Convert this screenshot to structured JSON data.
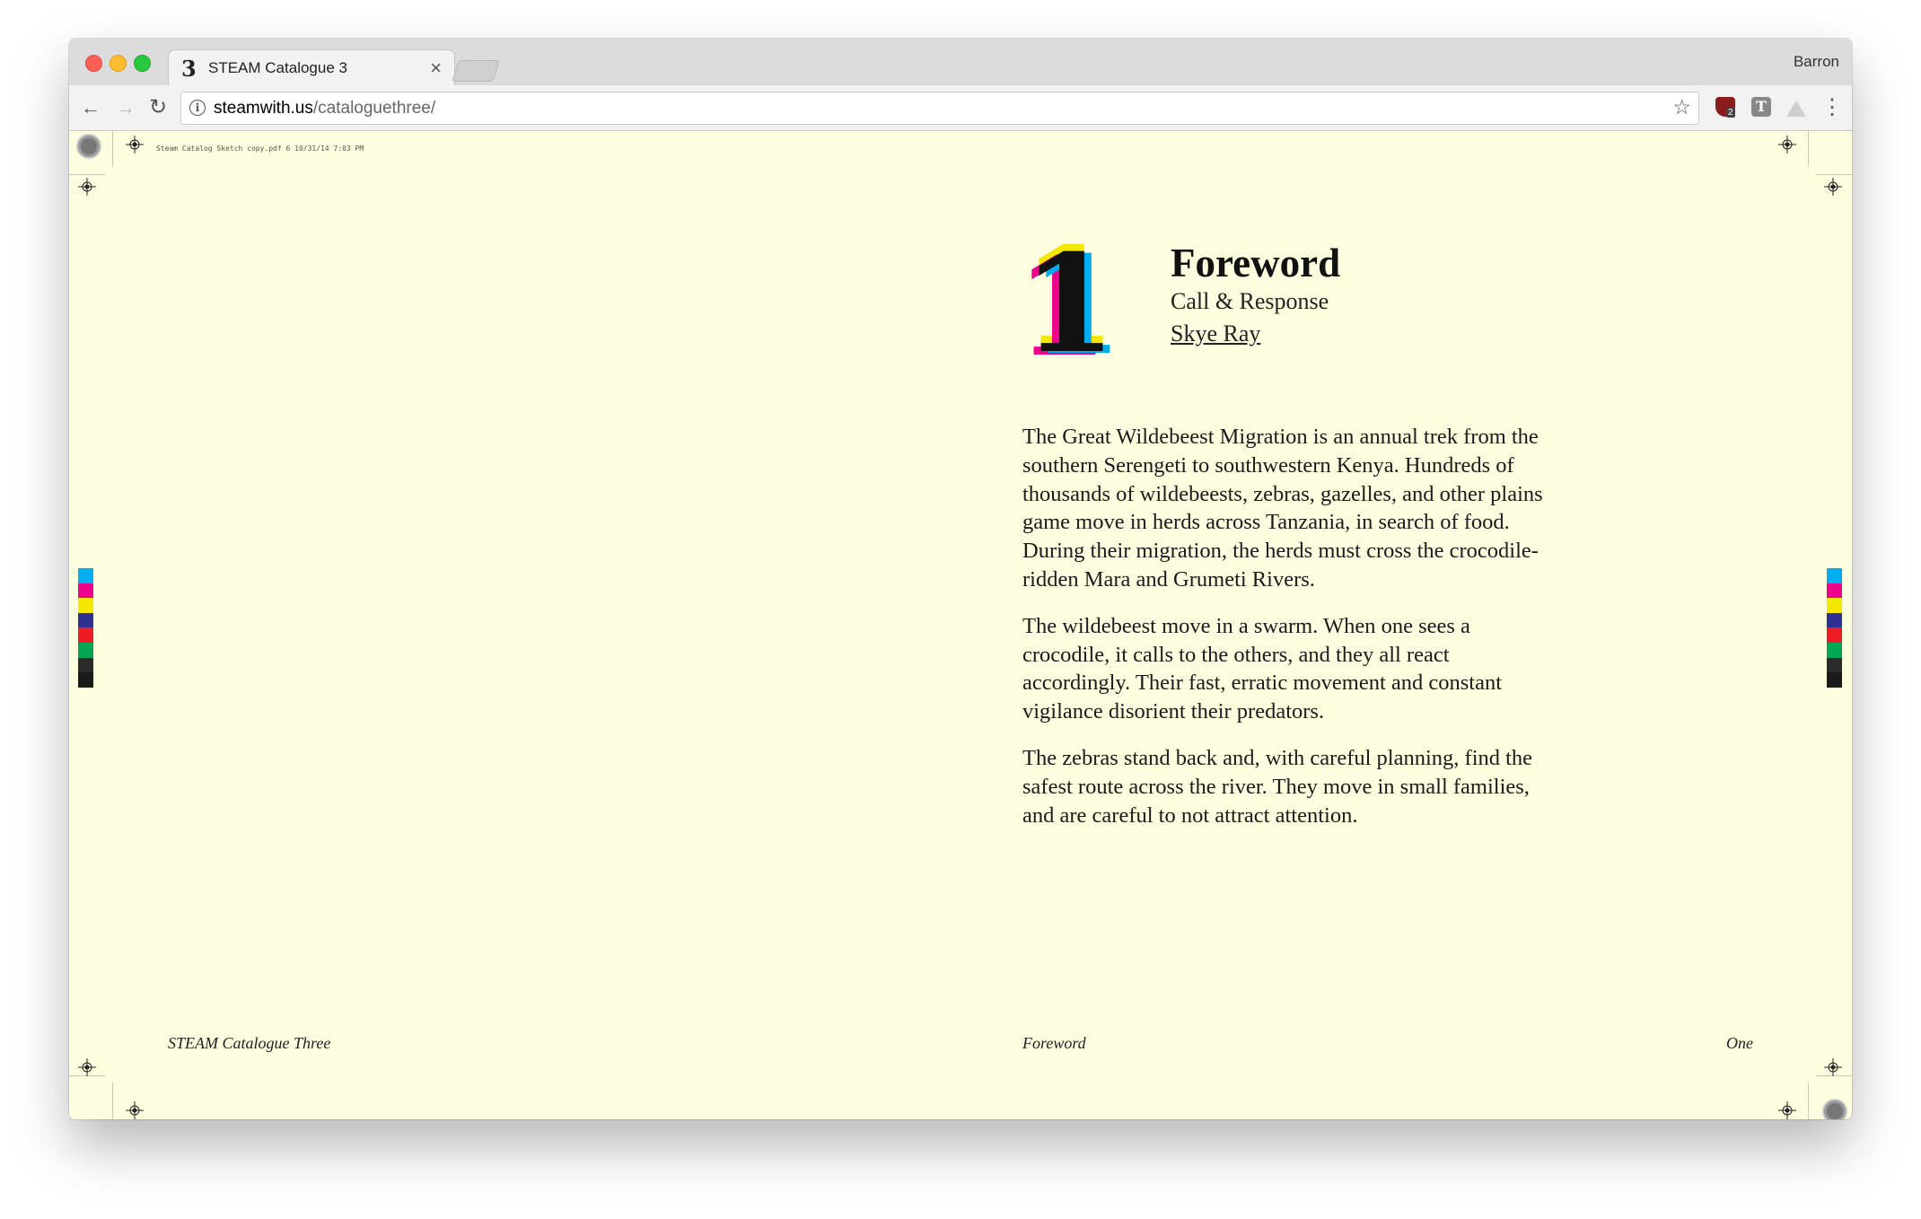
{
  "browser": {
    "tab": {
      "favicon": "3",
      "title": "STEAM Catalogue 3",
      "close": "×"
    },
    "profile": "Barron",
    "url": {
      "host": "steamwith.us",
      "path": "/cataloguethree/"
    },
    "icons": {
      "back": "←",
      "forward": "→",
      "reload": "↻",
      "star": "☆",
      "menu": "⋮",
      "info": "i",
      "ublock_badge": "2",
      "ext_t": "T"
    }
  },
  "page": {
    "slug": "Steam Catalog Sketch copy.pdf 6 10/31/14 7:03 PM",
    "chapter": {
      "number": "1",
      "title": "Foreword",
      "subtitle": "Call & Response",
      "author": "Skye Ray"
    },
    "paragraphs": [
      "The Great Wildebeest Migration is an annual trek from the southern Serengeti to southwestern Kenya. Hundreds of thousands of wildebeests, zebras, gazelles, and other plains game move in herds across Tanzania, in search of food. During their migration, the herds must cross the crocodile-ridden Mara and Grumeti Rivers.",
      "The wildebeest move in a swarm. When one sees a crocodile, it calls to the others, and they all react accordingly. Their fast, erratic movement and constant vigilance disorient their predators.",
      "The zebras stand back and, with careful planning, find the safest route across the river. They move in small families, and are careful to not attract attention."
    ],
    "footer": {
      "left": "STEAM Catalogue Three",
      "center": "Foreword",
      "right": "One"
    },
    "color_bar": [
      "#00aeef",
      "#ec008c",
      "#f4e800",
      "#2e3192",
      "#ed1c24",
      "#00a651",
      "#2b2b2b",
      "#1a1a1a"
    ],
    "gray_bar": [
      "#000000",
      "#1c1c1c",
      "#333333",
      "#4a4a4a",
      "#626262",
      "#7a7a7a",
      "#939393",
      "#acacac",
      "#c6c6c6",
      "#e0e0e0"
    ]
  }
}
